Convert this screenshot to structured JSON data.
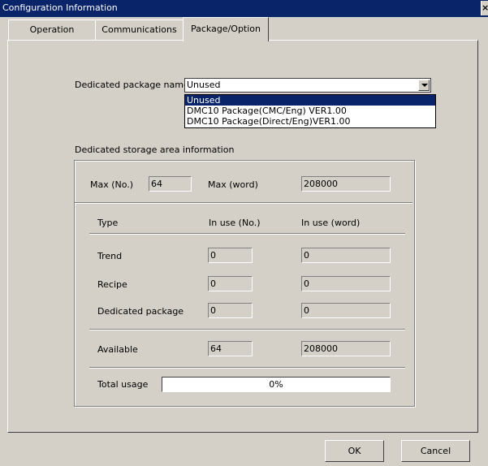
{
  "window": {
    "title": "Configuration Information",
    "close_glyph": "×"
  },
  "tabs": [
    {
      "label": "Operation"
    },
    {
      "label": "Communications"
    },
    {
      "label": "Package/Option",
      "active": true
    }
  ],
  "package": {
    "label": "Dedicated package name",
    "selected": "Unused",
    "options": [
      "Unused",
      "DMC10 Package(CMC/Eng) VER1.00",
      "DMC10 Package(Direct/Eng)VER1.00"
    ]
  },
  "storage": {
    "title": "Dedicated storage area information",
    "max_no_label": "Max (No.)",
    "max_no_value": "64",
    "max_word_label": "Max (word)",
    "max_word_value": "208000",
    "headers": {
      "type": "Type",
      "in_use_no": "In use (No.)",
      "in_use_word": "In use (word)"
    },
    "rows": [
      {
        "type": "Trend",
        "no": "0",
        "word": "0"
      },
      {
        "type": "Recipe",
        "no": "0",
        "word": "0"
      },
      {
        "type": "Dedicated package",
        "no": "0",
        "word": "0"
      }
    ],
    "available": {
      "label": "Available",
      "no": "64",
      "word": "208000"
    },
    "total_usage": {
      "label": "Total usage",
      "text": "0%",
      "percent": 0
    }
  },
  "buttons": {
    "ok": "OK",
    "cancel": "Cancel"
  }
}
